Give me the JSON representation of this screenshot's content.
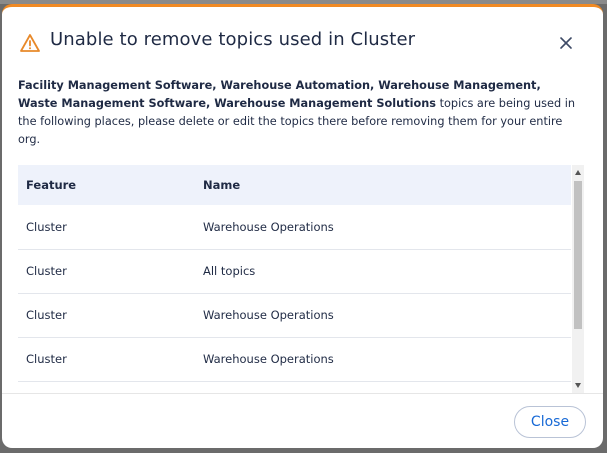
{
  "dialog": {
    "title": "Unable to remove topics used in Cluster",
    "description_bold": "Facility Management Software, Warehouse Automation, Warehouse Management, Waste Management Software, Warehouse Management Solutions",
    "description_rest": " topics are being used in the following places, please delete or edit the topics there before removing them for your entire org.",
    "close_label": "Close"
  },
  "table": {
    "headers": [
      "Feature",
      "Name"
    ],
    "rows": [
      [
        "Cluster",
        "Warehouse Operations"
      ],
      [
        "Cluster",
        "All topics"
      ],
      [
        "Cluster",
        "Warehouse Operations"
      ],
      [
        "Cluster",
        "Warehouse Operations"
      ],
      [
        "",
        ""
      ]
    ]
  },
  "colors": {
    "accent": "#f08a24",
    "link": "#1769d6",
    "header_bg": "#eef2fb"
  },
  "icons": {
    "warning": "warning-triangle-icon",
    "close": "close-icon"
  }
}
